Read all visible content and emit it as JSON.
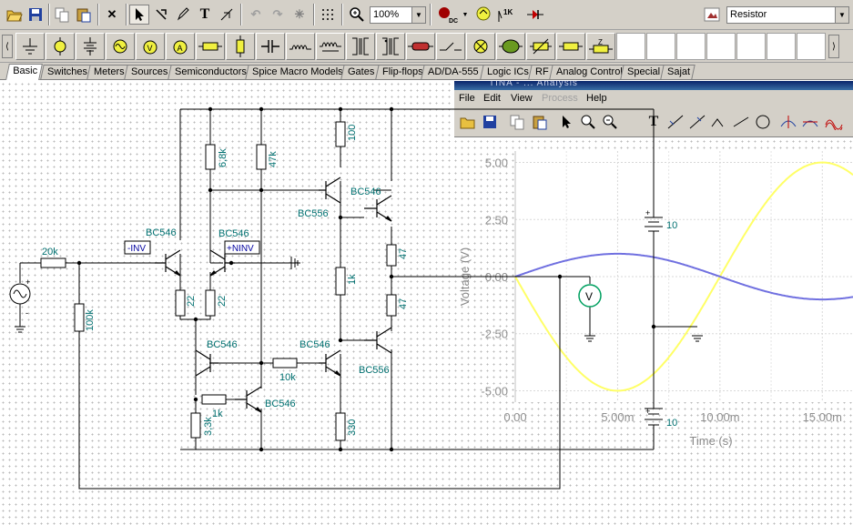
{
  "toolbar": {
    "zoom_value": "100%",
    "dc_label": "DC",
    "component_value": "Resistor"
  },
  "tabs": [
    {
      "label": "Basic"
    },
    {
      "label": "Switches"
    },
    {
      "label": "Meters"
    },
    {
      "label": "Sources"
    },
    {
      "label": "Semiconductors"
    },
    {
      "label": "Spice Macro Models"
    },
    {
      "label": "Gates"
    },
    {
      "label": "Flip-flops"
    },
    {
      "label": "AD/DA-555"
    },
    {
      "label": "Logic ICs"
    },
    {
      "label": "RF"
    },
    {
      "label": "Analog Control"
    },
    {
      "label": "Special"
    },
    {
      "label": "Sajat"
    }
  ],
  "schematic": {
    "labels": {
      "r_20k": "20k",
      "r_100k": "100k",
      "r_6_8k": "6,8k",
      "r_47k": "47k",
      "r_100": "100",
      "r_22a": "22",
      "r_22b": "22",
      "r_1k_mid": "1k",
      "r_47a": "47",
      "r_47b": "47",
      "r_10k": "10k",
      "r_1k_low": "1k",
      "r_3_3k": "3,3k",
      "r_330": "330",
      "q1": "BC546",
      "q2": "BC546",
      "q3": "BC546",
      "q4": "BC556",
      "q5": "BC546",
      "q6": "BC546",
      "q7": "BC546",
      "q8": "BC556",
      "q9": "BC546",
      "q10": "BC556",
      "inv": "-INV",
      "ninv": "+NINV",
      "bat_top": "10",
      "bat_bot": "10",
      "plus_src": "+",
      "minus_src": "-",
      "plus_bat1": "+",
      "plus_bat2": "+",
      "voltmeter": "V"
    }
  },
  "grapher": {
    "title_fragment": "TINA - ... Analysis",
    "menu": [
      {
        "label": "File",
        "disabled": false
      },
      {
        "label": "Edit",
        "disabled": false
      },
      {
        "label": "View",
        "disabled": false
      },
      {
        "label": "Process",
        "disabled": true
      },
      {
        "label": "Help",
        "disabled": false
      }
    ]
  },
  "chart_data": {
    "type": "line",
    "xlabel": "Time (s)",
    "ylabel": "Voltage (V)",
    "x_ticks": [
      "0.00",
      "5.00m",
      "10.00m",
      "15.00m"
    ],
    "y_ticks": [
      "5.00",
      "2.50",
      "0.00",
      "-2.50",
      "-5.00"
    ],
    "xlim": [
      0,
      0.0165
    ],
    "ylim": [
      -5.5,
      5.5
    ],
    "series": [
      {
        "color": "#ffff66",
        "amplitude": 5,
        "period": 0.02,
        "phase": "negative-sine",
        "x": [
          0,
          0.0025,
          0.005,
          0.0075,
          0.01,
          0.0125,
          0.015
        ],
        "y": [
          0,
          -3.54,
          -5,
          -3.54,
          0,
          3.54,
          5
        ]
      },
      {
        "color": "#7070e0",
        "amplitude": 1,
        "period": 0.02,
        "phase": "sine",
        "x": [
          0,
          0.0025,
          0.005,
          0.0075,
          0.01,
          0.0125,
          0.015
        ],
        "y": [
          0,
          0.71,
          1,
          0.71,
          0,
          -0.71,
          -1
        ]
      }
    ],
    "grid": true
  }
}
